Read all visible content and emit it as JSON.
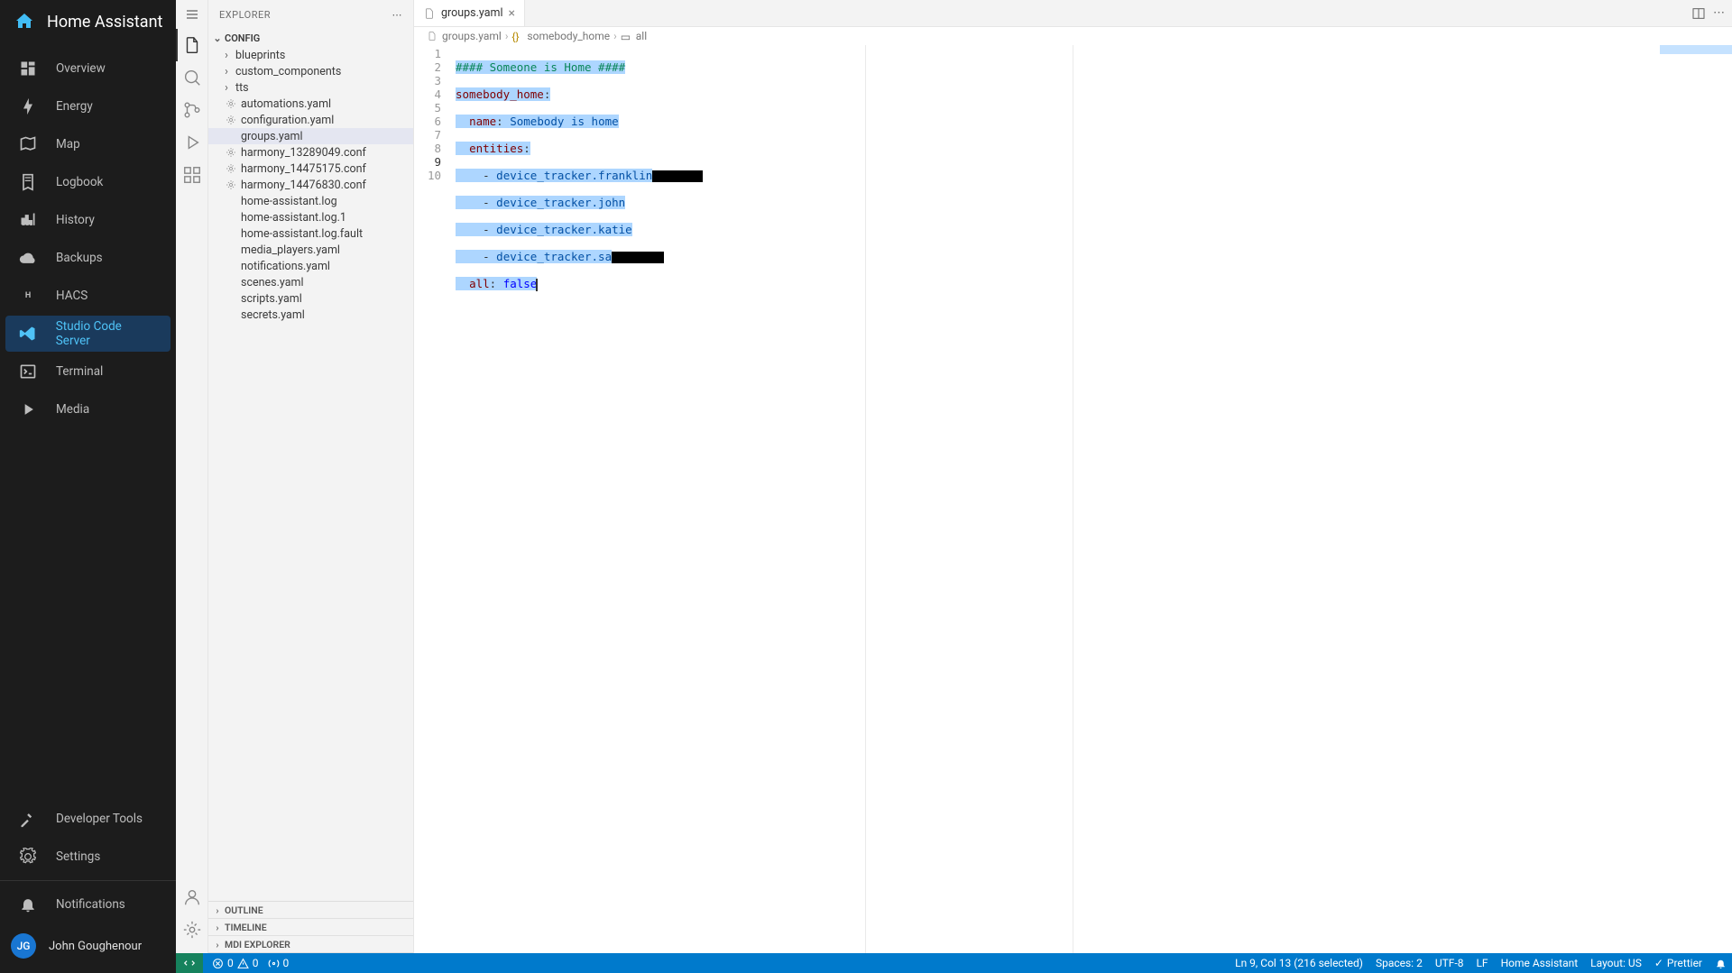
{
  "ha": {
    "title": "Home Assistant",
    "nav": [
      {
        "id": "overview",
        "label": "Overview",
        "icon": "view-dashboard"
      },
      {
        "id": "energy",
        "label": "Energy",
        "icon": "lightning"
      },
      {
        "id": "map",
        "label": "Map",
        "icon": "map"
      },
      {
        "id": "logbook",
        "label": "Logbook",
        "icon": "book"
      },
      {
        "id": "history",
        "label": "History",
        "icon": "chart"
      },
      {
        "id": "backups",
        "label": "Backups",
        "icon": "cloud"
      },
      {
        "id": "hacs",
        "label": "HACS",
        "icon": "hacs"
      },
      {
        "id": "studio",
        "label": "Studio Code Server",
        "icon": "vscode",
        "active": true
      },
      {
        "id": "terminal",
        "label": "Terminal",
        "icon": "terminal"
      },
      {
        "id": "media",
        "label": "Media",
        "icon": "play"
      }
    ],
    "bottom": [
      {
        "id": "devtools",
        "label": "Developer Tools",
        "icon": "hammer"
      },
      {
        "id": "settings",
        "label": "Settings",
        "icon": "cog"
      }
    ],
    "notifications": {
      "label": "Notifications",
      "icon": "bell"
    },
    "user": {
      "initials": "JG",
      "name": "John Goughenour"
    }
  },
  "explorer": {
    "title": "EXPLORER",
    "root": "CONFIG",
    "items": [
      {
        "name": "blueprints",
        "type": "folder"
      },
      {
        "name": "custom_components",
        "type": "folder"
      },
      {
        "name": "tts",
        "type": "folder"
      },
      {
        "name": "automations.yaml",
        "type": "file",
        "icon": "gear"
      },
      {
        "name": "configuration.yaml",
        "type": "file",
        "icon": "gear"
      },
      {
        "name": "groups.yaml",
        "type": "file",
        "selected": true
      },
      {
        "name": "harmony_13289049.conf",
        "type": "file",
        "icon": "gear"
      },
      {
        "name": "harmony_14475175.conf",
        "type": "file",
        "icon": "gear"
      },
      {
        "name": "harmony_14476830.conf",
        "type": "file",
        "icon": "gear"
      },
      {
        "name": "home-assistant.log",
        "type": "file"
      },
      {
        "name": "home-assistant.log.1",
        "type": "file"
      },
      {
        "name": "home-assistant.log.fault",
        "type": "file"
      },
      {
        "name": "media_players.yaml",
        "type": "file"
      },
      {
        "name": "notifications.yaml",
        "type": "file"
      },
      {
        "name": "scenes.yaml",
        "type": "file"
      },
      {
        "name": "scripts.yaml",
        "type": "file"
      },
      {
        "name": "secrets.yaml",
        "type": "file"
      }
    ],
    "sections": [
      "OUTLINE",
      "TIMELINE",
      "MDI EXPLORER"
    ]
  },
  "editor": {
    "tab": {
      "name": "groups.yaml"
    },
    "breadcrumbs": [
      "groups.yaml",
      "somebody_home",
      "all"
    ],
    "lines": {
      "l1": "#### Someone is Home ####",
      "l2_key": "somebody_home",
      "l3_key": "name",
      "l3_val": "Somebody is home",
      "l4_key": "entities",
      "l5": "device_tracker.franklin",
      "l6": "device_tracker.john",
      "l7": "device_tracker.katie",
      "l8": "device_tracker.sa",
      "l9_key": "all",
      "l9_val": "false"
    },
    "line_count": 10
  },
  "statusbar": {
    "errors": "0",
    "warnings": "0",
    "ports": "0",
    "cursor": "Ln 9, Col 13 (216 selected)",
    "spaces": "Spaces: 2",
    "encoding": "UTF-8",
    "eol": "LF",
    "lang": "Home Assistant",
    "layout": "Layout: US",
    "prettier": "Prettier",
    "bell": "bell"
  }
}
